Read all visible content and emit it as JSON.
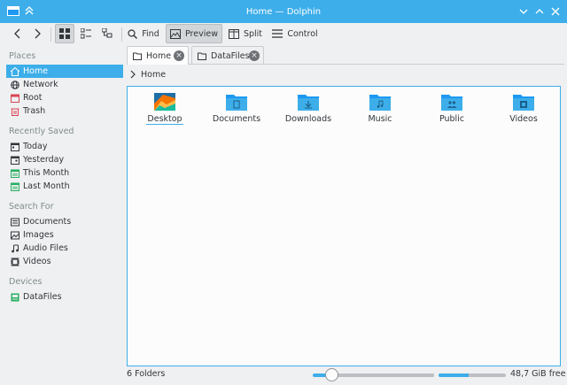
{
  "window": {
    "title": "Home — Dolphin"
  },
  "toolbar": {
    "find": "Find",
    "preview": "Preview",
    "split": "Split",
    "control": "Control"
  },
  "places": {
    "sections": [
      {
        "title": "Places",
        "items": [
          {
            "label": "Home",
            "icon": "home-icon"
          },
          {
            "label": "Network",
            "icon": "network-icon"
          },
          {
            "label": "Root",
            "icon": "root-icon"
          },
          {
            "label": "Trash",
            "icon": "trash-icon"
          }
        ]
      },
      {
        "title": "Recently Saved",
        "items": [
          {
            "label": "Today",
            "icon": "calendar-icon"
          },
          {
            "label": "Yesterday",
            "icon": "calendar-icon"
          },
          {
            "label": "This Month",
            "icon": "calendar-icon"
          },
          {
            "label": "Last Month",
            "icon": "calendar-icon"
          }
        ]
      },
      {
        "title": "Search For",
        "items": [
          {
            "label": "Documents",
            "icon": "documents-icon"
          },
          {
            "label": "Images",
            "icon": "images-icon"
          },
          {
            "label": "Audio Files",
            "icon": "music-note-icon"
          },
          {
            "label": "Videos",
            "icon": "video-icon"
          }
        ]
      },
      {
        "title": "Devices",
        "items": [
          {
            "label": "DataFiles",
            "icon": "drive-icon"
          }
        ]
      }
    ]
  },
  "tabs": [
    {
      "label": "Home"
    },
    {
      "label": "DataFiles"
    }
  ],
  "breadcrumb": {
    "path": "Home"
  },
  "folders": [
    {
      "name": "Desktop",
      "icon": "desktop-folder-icon"
    },
    {
      "name": "Documents",
      "icon": "documents-folder-icon"
    },
    {
      "name": "Downloads",
      "icon": "downloads-folder-icon"
    },
    {
      "name": "Music",
      "icon": "music-folder-icon"
    },
    {
      "name": "Public",
      "icon": "public-folder-icon"
    },
    {
      "name": "Videos",
      "icon": "videos-folder-icon"
    }
  ],
  "status": {
    "count": "6 Folders",
    "free": "48,7 GiB free",
    "zoom_level": 0.15,
    "disk_used_fraction": 0.45
  },
  "colors": {
    "accent": "#3daee9",
    "window_bg": "#eff0f1",
    "view_bg": "#fcfcfc",
    "text": "#31363b"
  }
}
